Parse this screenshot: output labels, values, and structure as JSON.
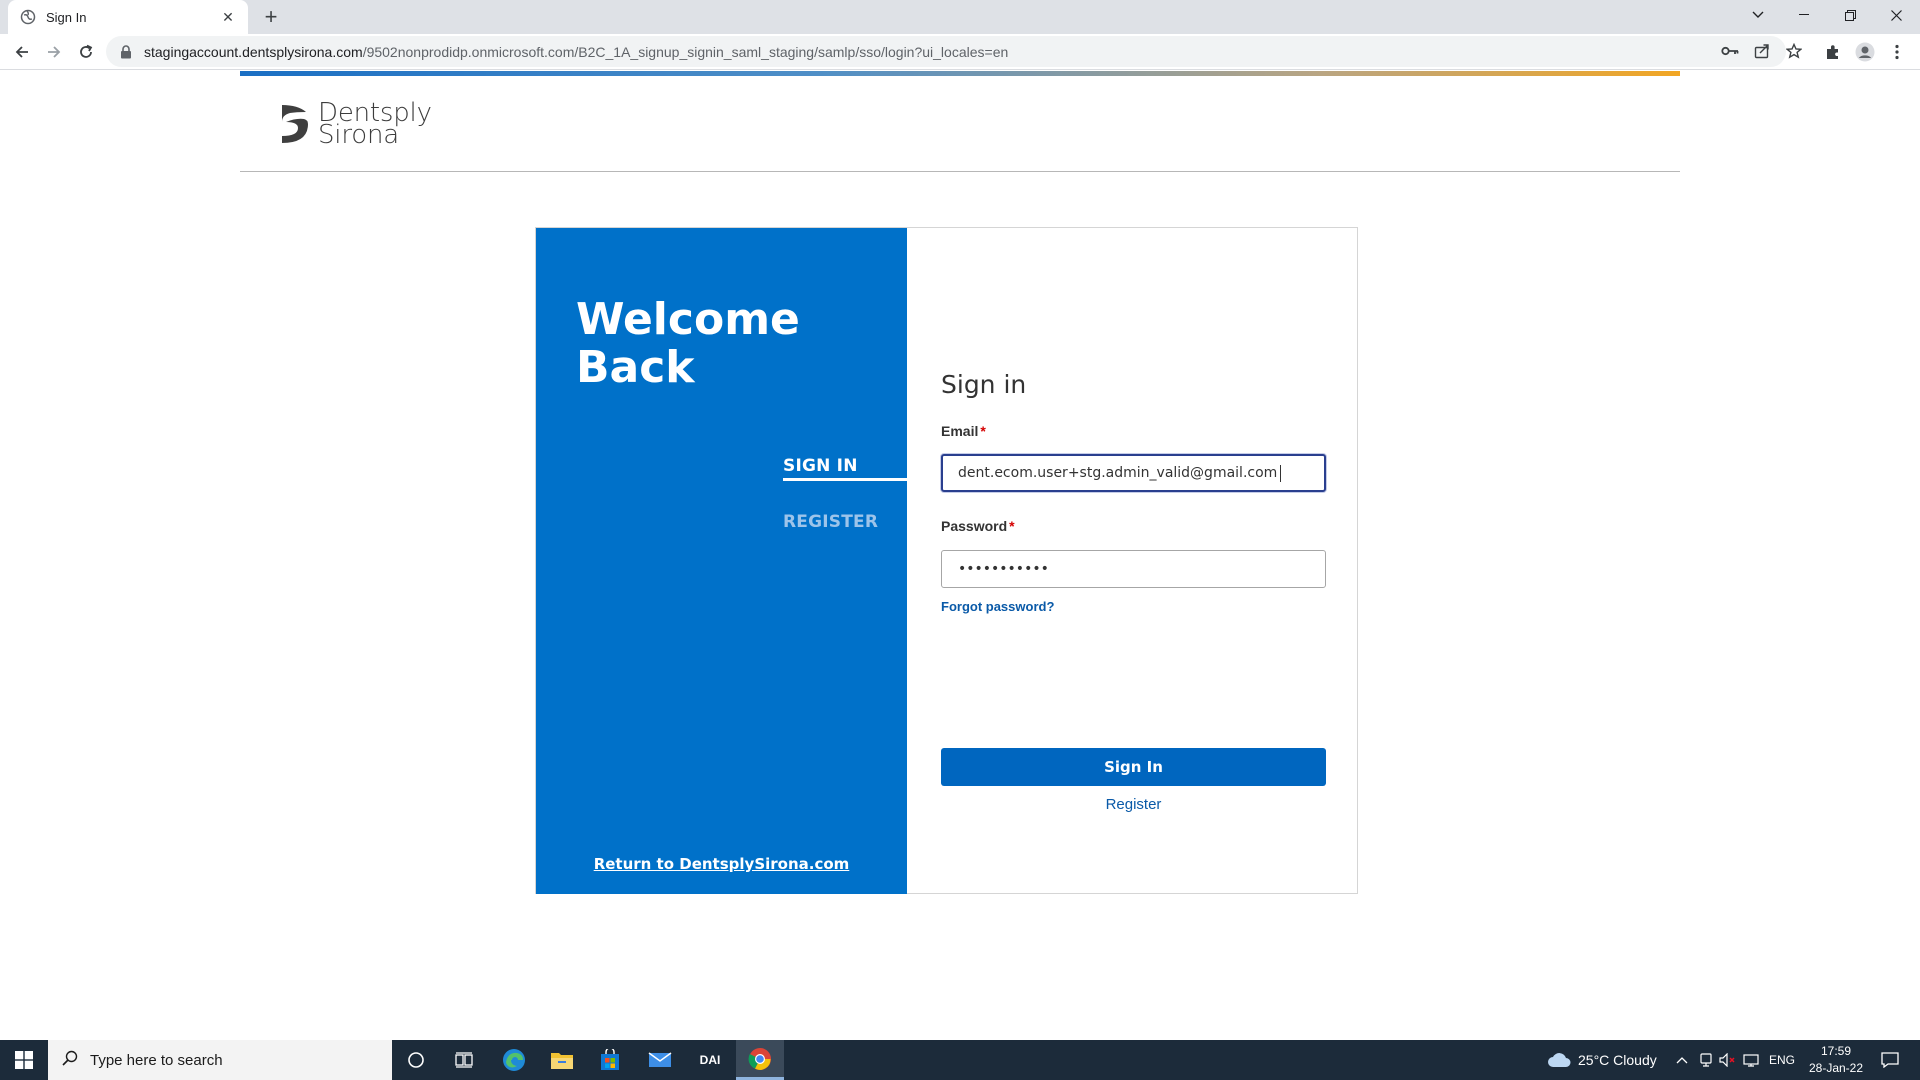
{
  "browser": {
    "tab_title": "Sign In",
    "new_tab_symbol": "+",
    "url_domain": "stagingaccount.dentsplysirona.com",
    "url_path": "/9502nonprodidp.onmicrosoft.com/B2C_1A_signup_signin_saml_staging/samlp/sso/login?ui_locales=en"
  },
  "page": {
    "logo": {
      "line1": "Dentsply",
      "line2": "Sirona"
    },
    "welcome": {
      "line1": "Welcome",
      "line2": "Back"
    },
    "side_tabs": {
      "signin": "SIGN IN",
      "register": "REGISTER"
    },
    "return_link": "Return to DentsplySirona.com",
    "form": {
      "title": "Sign in",
      "email_label": "Email",
      "email_value": "dent.ecom.user+stg.admin_valid@gmail.com",
      "password_label": "Password",
      "password_value": "•••••••••••",
      "required_mark": "*",
      "forgot_link": "Forgot password?",
      "submit_label": "Sign In",
      "register_link": "Register"
    },
    "colors": {
      "brand_blue": "#0071c9",
      "button_blue": "#0066bf",
      "link_blue": "#0a5aa8",
      "required_red": "#d40000"
    }
  },
  "taskbar": {
    "search_placeholder": "Type here to search",
    "dai_label": "DAI",
    "weather": "25°C  Cloudy",
    "language": "ENG",
    "time": "17:59",
    "date": "28-Jan-22"
  }
}
